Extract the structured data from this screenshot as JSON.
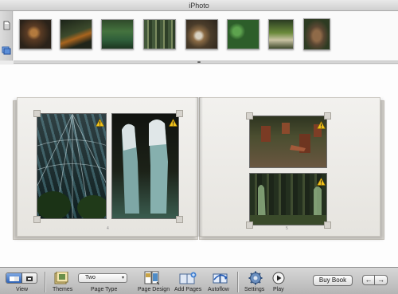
{
  "window": {
    "title": "iPhoto"
  },
  "browser": {
    "left_buttons": [
      {
        "icon": "document-icon"
      },
      {
        "icon": "photos-icon"
      }
    ],
    "thumbnails": [
      {
        "name": "statue-dark-garden"
      },
      {
        "name": "night-sculpture"
      },
      {
        "name": "green-pond"
      },
      {
        "name": "forest-trees"
      },
      {
        "name": "stones-on-table"
      },
      {
        "name": "lily-pads"
      },
      {
        "name": "plant-sculpture"
      },
      {
        "name": "tree-stump"
      }
    ]
  },
  "book": {
    "left_page_number": "4",
    "right_page_number": "5",
    "warning_icon": "warning-icon"
  },
  "toolbar": {
    "view_label": "View",
    "themes_label": "Themes",
    "page_type_value": "Two",
    "page_type_label": "Page Type",
    "page_design_label": "Page Design",
    "add_pages_label": "Add Pages",
    "autoflow_label": "Autoflow",
    "settings_label": "Settings",
    "play_label": "Play",
    "buy_book_label": "Buy Book",
    "prev_arrow": "←",
    "next_arrow": "→"
  }
}
